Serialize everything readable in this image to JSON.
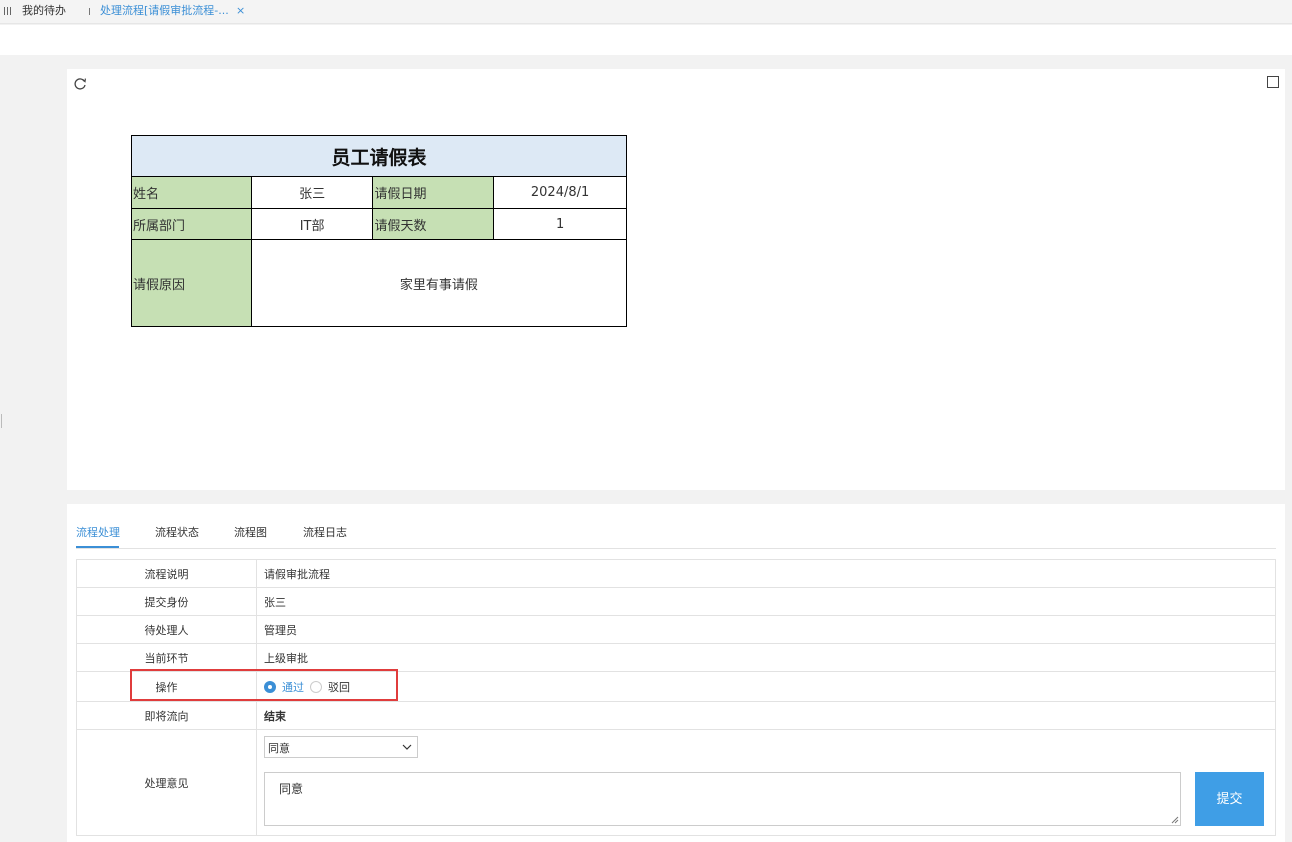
{
  "tabbar": {
    "home_label": "我的待办",
    "active_label": "处理流程[请假审批流程-...",
    "close_label": "×"
  },
  "leave_form": {
    "title": "员工请假表",
    "name_label": "姓名",
    "name_value": "张三",
    "date_label": "请假日期",
    "date_value": "2024/8/1",
    "dept_label": "所属部门",
    "dept_value": "IT部",
    "days_label": "请假天数",
    "days_value": "1",
    "reason_label": "请假原因",
    "reason_value": "家里有事请假"
  },
  "process_tabs": [
    "流程处理",
    "流程状态",
    "流程图",
    "流程日志"
  ],
  "process_info": {
    "desc_label": "流程说明",
    "desc_value": "请假审批流程",
    "submitter_label": "提交身份",
    "submitter_value": "张三",
    "handler_label": "待处理人",
    "handler_value": "管理员",
    "node_label": "当前环节",
    "node_value": "上级审批",
    "op_label": "操作",
    "op_pass": "通过",
    "op_reject": "驳回",
    "op_selected": "通过",
    "next_label": "即将流向",
    "next_value": "结束",
    "opinion_label": "处理意见",
    "opinion_select": "同意",
    "opinion_text": "同意",
    "submit_label": "提交"
  },
  "colors": {
    "accent": "#3b8fd6",
    "header_fill": "#dde9f5",
    "label_fill": "#c6e0b4",
    "highlight": "#e03c3c",
    "button": "#3f9ee6"
  }
}
